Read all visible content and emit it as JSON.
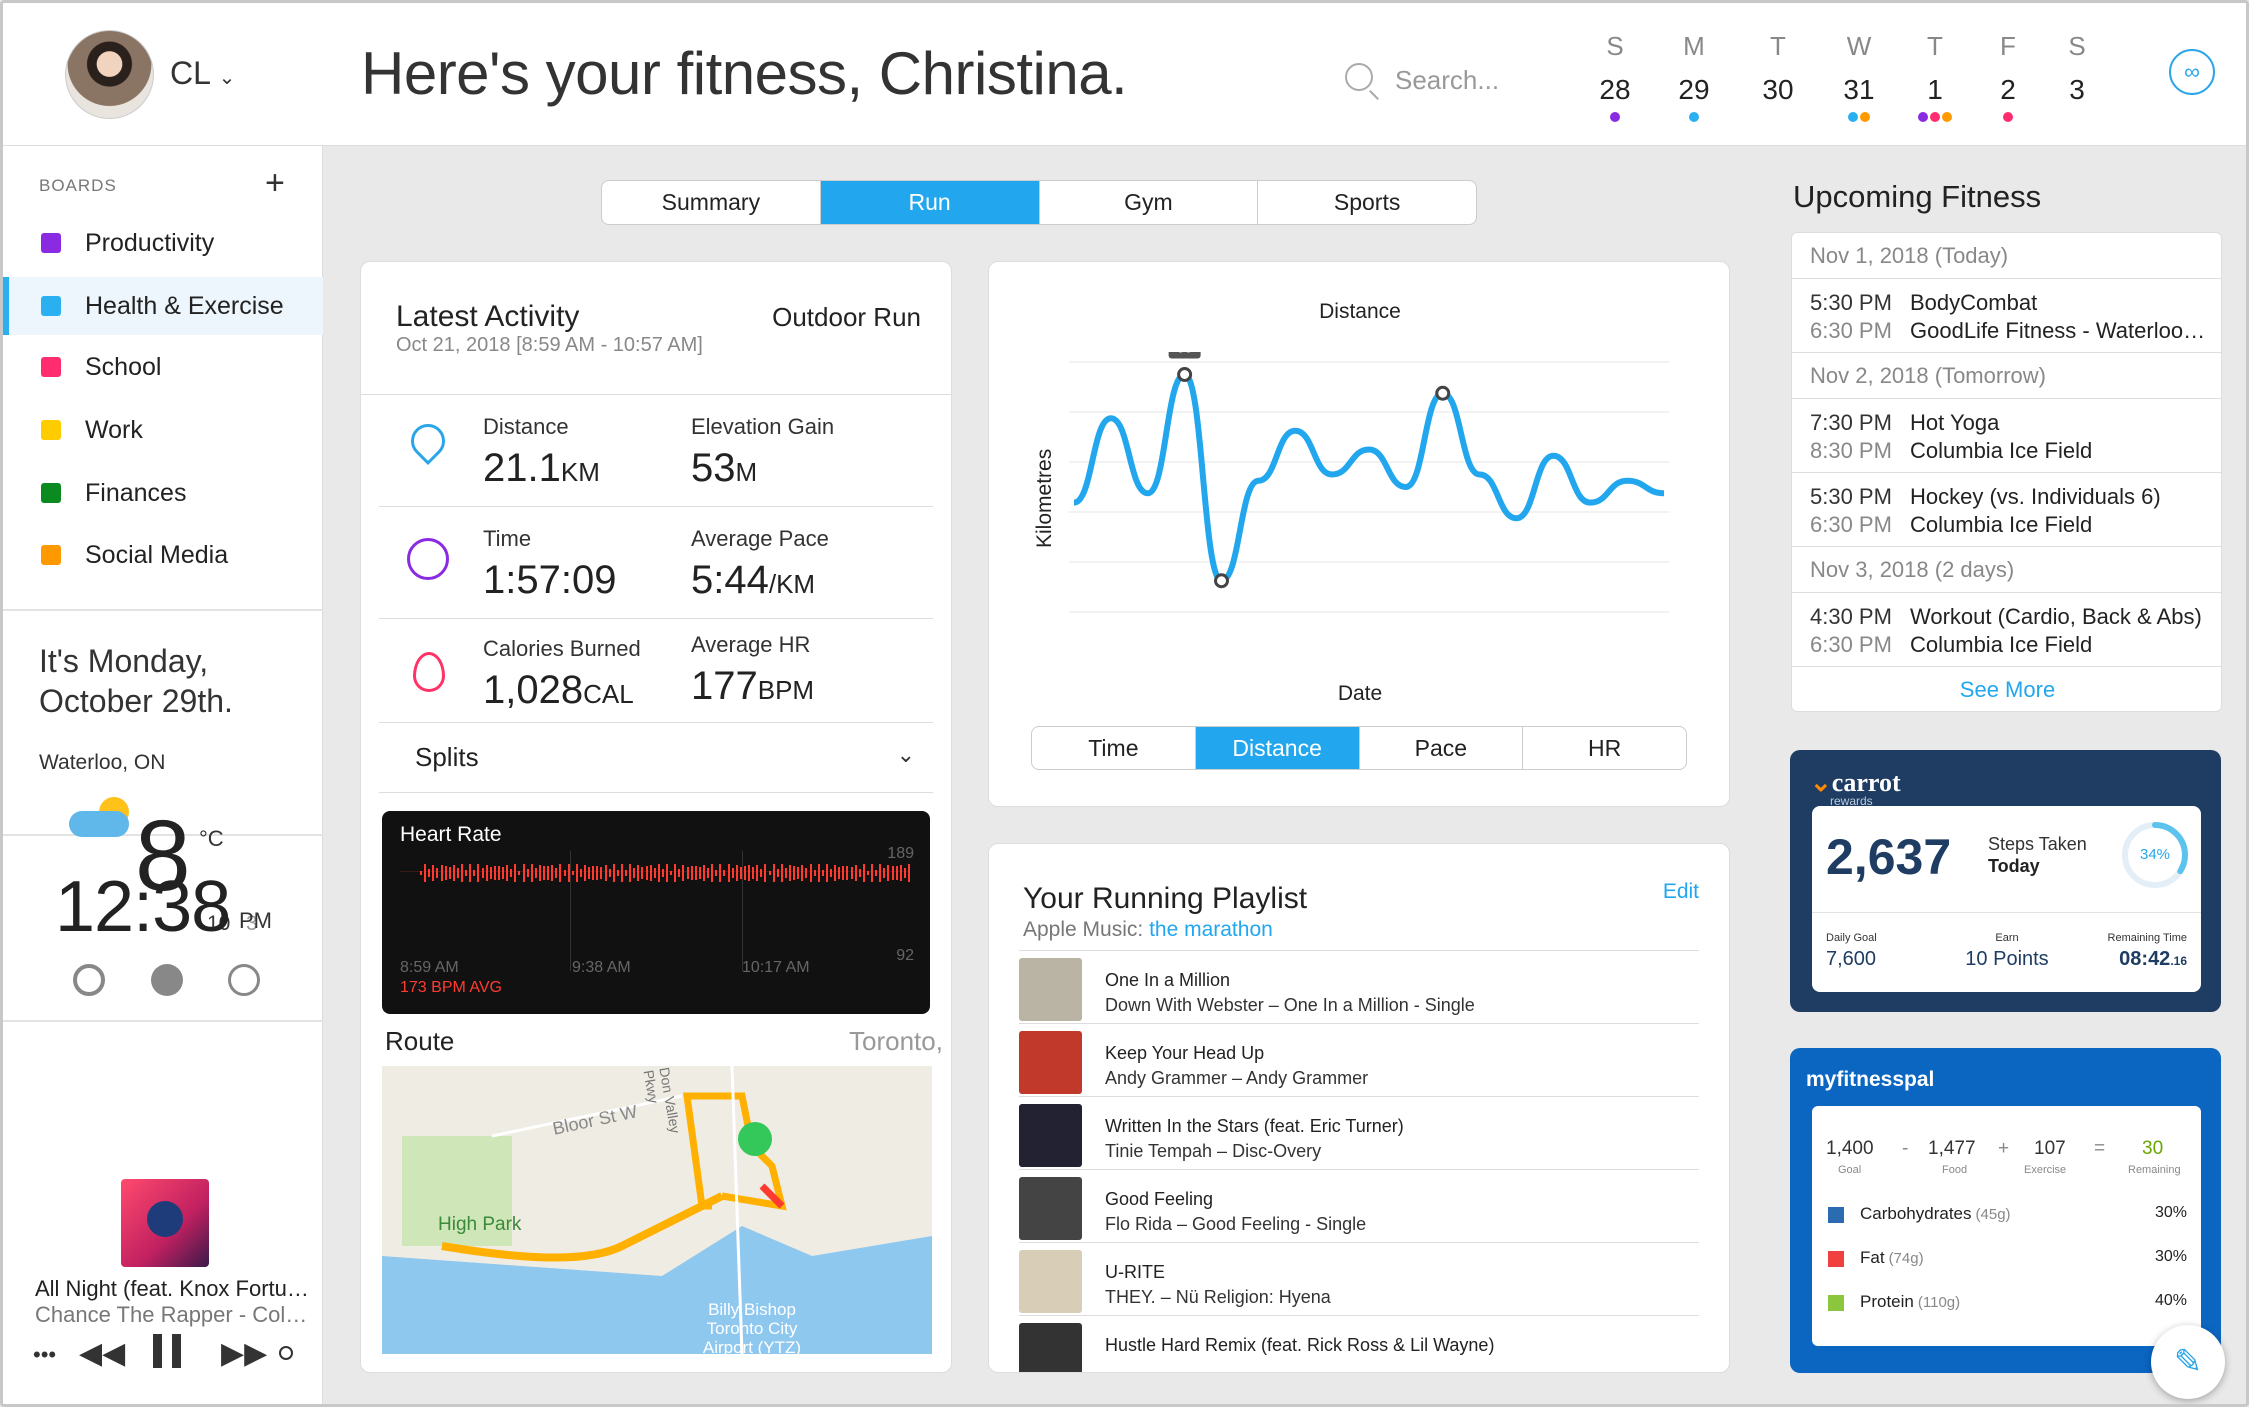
{
  "header": {
    "initials": "CL",
    "title": "Here's your fitness, Christina.",
    "search_placeholder": "Search...",
    "calendar": [
      {
        "day": "S",
        "num": "28",
        "dots": [
          "#8a2be2"
        ]
      },
      {
        "day": "M",
        "num": "29",
        "dots": [
          "#2ab0f0"
        ]
      },
      {
        "day": "T",
        "num": "30",
        "dots": []
      },
      {
        "day": "W",
        "num": "31",
        "dots": [
          "#2ab0f0",
          "#ff9900"
        ]
      },
      {
        "day": "T",
        "num": "1",
        "dots": [
          "#8a2be2",
          "#ff2d6f",
          "#ff9900"
        ]
      },
      {
        "day": "F",
        "num": "2",
        "dots": [
          "#ff2d6f"
        ]
      },
      {
        "day": "S",
        "num": "3",
        "dots": []
      }
    ]
  },
  "sidebar": {
    "boards_heading": "BOARDS",
    "add_label": "+",
    "boards": [
      {
        "label": "Productivity",
        "color": "#8a2be2"
      },
      {
        "label": "Health & Exercise",
        "color": "#2ab0f0"
      },
      {
        "label": "School",
        "color": "#ff2d6f"
      },
      {
        "label": "Work",
        "color": "#ffcc00"
      },
      {
        "label": "Finances",
        "color": "#0a8a1f"
      },
      {
        "label": "Social Media",
        "color": "#ff9900"
      }
    ],
    "date_line1": "It's Monday,",
    "date_line2": "October 29th.",
    "location": "Waterloo, ON",
    "temp": "8",
    "temp_unit": "°C",
    "temp_high": "10",
    "temp_low": "3",
    "clock": "12:38",
    "clock_ampm": "PM",
    "now_playing_title": "All Night (feat. Knox Fortu…",
    "now_playing_artist": "Chance The Rapper - Col…"
  },
  "tabs": {
    "summary": "Summary",
    "run": "Run",
    "gym": "Gym",
    "sports": "Sports"
  },
  "activity": {
    "title": "Latest Activity",
    "date": "Oct 21, 2018 [8:59 AM - 10:57 AM]",
    "type": "Outdoor Run",
    "distance_label": "Distance",
    "distance_value": "21.1",
    "distance_unit": "KM",
    "elev_label": "Elevation Gain",
    "elev_value": "53",
    "elev_unit": "M",
    "time_label": "Time",
    "time_value": "1:57:09",
    "pace_label": "Average Pace",
    "pace_value": "5:44",
    "pace_unit": "/KM",
    "cal_label": "Calories Burned",
    "cal_value": "1,028",
    "cal_unit": "CAL",
    "hr_label": "Average HR",
    "hr_value": "177",
    "hr_unit": "BPM",
    "splits_label": "Splits",
    "heart_title": "Heart Rate",
    "heart_max": "189",
    "heart_min": "92",
    "heart_t1": "8:59 AM",
    "heart_t2": "9:38 AM",
    "heart_t3": "10:17 AM",
    "heart_avg": "173 BPM AVG",
    "route_label": "Route",
    "route_city": "Toronto, ON",
    "map_street": "Bloor St W",
    "map_park": "High Park",
    "map_airport": "Billy Bishop Toronto City Airport (YTZ)",
    "map_road": "Don Valley Pkwy"
  },
  "chart_data": {
    "type": "line",
    "title": "Distance",
    "xlabel": "Date",
    "ylabel": "Kilometres",
    "peak_label": "96",
    "x": [
      0,
      1,
      2,
      3,
      4,
      5,
      6,
      7,
      8,
      9,
      10,
      11,
      12,
      13,
      14,
      15,
      16
    ],
    "values": [
      55,
      82,
      58,
      96,
      30,
      62,
      78,
      64,
      72,
      60,
      90,
      64,
      50,
      70,
      55,
      62,
      58
    ]
  },
  "chart_tabs": {
    "time": "Time",
    "distance": "Distance",
    "pace": "Pace",
    "hr": "HR"
  },
  "playlist": {
    "title": "Your Running Playlist",
    "source_prefix": "Apple Music: ",
    "source_link": "the marathon",
    "edit": "Edit",
    "tracks": [
      {
        "title": "One In a Million",
        "sub": "Down With Webster – One In a Million - Single"
      },
      {
        "title": "Keep Your Head Up",
        "sub": "Andy Grammer – Andy Grammer"
      },
      {
        "title": "Written In the Stars (feat. Eric Turner)",
        "sub": "Tinie Tempah – Disc-Overy"
      },
      {
        "title": "Good Feeling",
        "sub": "Flo Rida – Good Feeling - Single"
      },
      {
        "title": "U-RITE",
        "sub": "THEY. – Nü Religion: Hyena"
      },
      {
        "title": "Hustle Hard Remix (feat. Rick Ross & Lil Wayne)",
        "sub": ""
      }
    ]
  },
  "upcoming": {
    "title": "Upcoming Fitness",
    "groups": [
      {
        "date": "Nov 1, 2018 (Today)",
        "events": [
          {
            "t1": "5:30 PM",
            "n": "BodyCombat",
            "t2": "6:30 PM",
            "loc": "GoodLife Fitness - Waterloo…"
          }
        ]
      },
      {
        "date": "Nov 2, 2018 (Tomorrow)",
        "events": [
          {
            "t1": "7:30 PM",
            "n": "Hot Yoga",
            "t2": "8:30 PM",
            "loc": "Columbia Ice Field"
          },
          {
            "t1": "5:30 PM",
            "n": "Hockey (vs. Individuals 6)",
            "t2": "6:30 PM",
            "loc": "Columbia Ice Field"
          }
        ]
      },
      {
        "date": "Nov 3, 2018 (2 days)",
        "events": [
          {
            "t1": "4:30 PM",
            "n": "Workout (Cardio, Back & Abs)",
            "t2": "6:30 PM",
            "loc": "Columbia Ice Field"
          }
        ]
      }
    ],
    "see_more": "See More"
  },
  "carrot": {
    "brand": "carrot",
    "brand_sub": "rewards",
    "steps": "2,637",
    "steps_label": "Steps Taken",
    "steps_when": "Today",
    "percent": "34%",
    "percent_value": 34,
    "goal_label": "Daily Goal",
    "goal": "7,600",
    "earn_label": "Earn",
    "earn": "10 Points",
    "remain_label": "Remaining Time",
    "remain": "08:42",
    "remain_small": ".16"
  },
  "mfp": {
    "brand": "myfitnesspal",
    "goal": "1,400",
    "goal_label": "Goal",
    "food": "1,477",
    "food_label": "Food",
    "exercise": "107",
    "exercise_label": "Exercise",
    "remaining": "30",
    "remaining_label": "Remaining",
    "minus": "-",
    "plus": "+",
    "eq": "=",
    "macros": [
      {
        "name": "Carbohydrates",
        "grams": "(45g)",
        "pct": "30%",
        "color": "#2b6cb0"
      },
      {
        "name": "Fat",
        "grams": "(74g)",
        "pct": "30%",
        "color": "#f04040"
      },
      {
        "name": "Protein",
        "grams": "(110g)",
        "pct": "40%",
        "color": "#8cc63f"
      }
    ]
  }
}
